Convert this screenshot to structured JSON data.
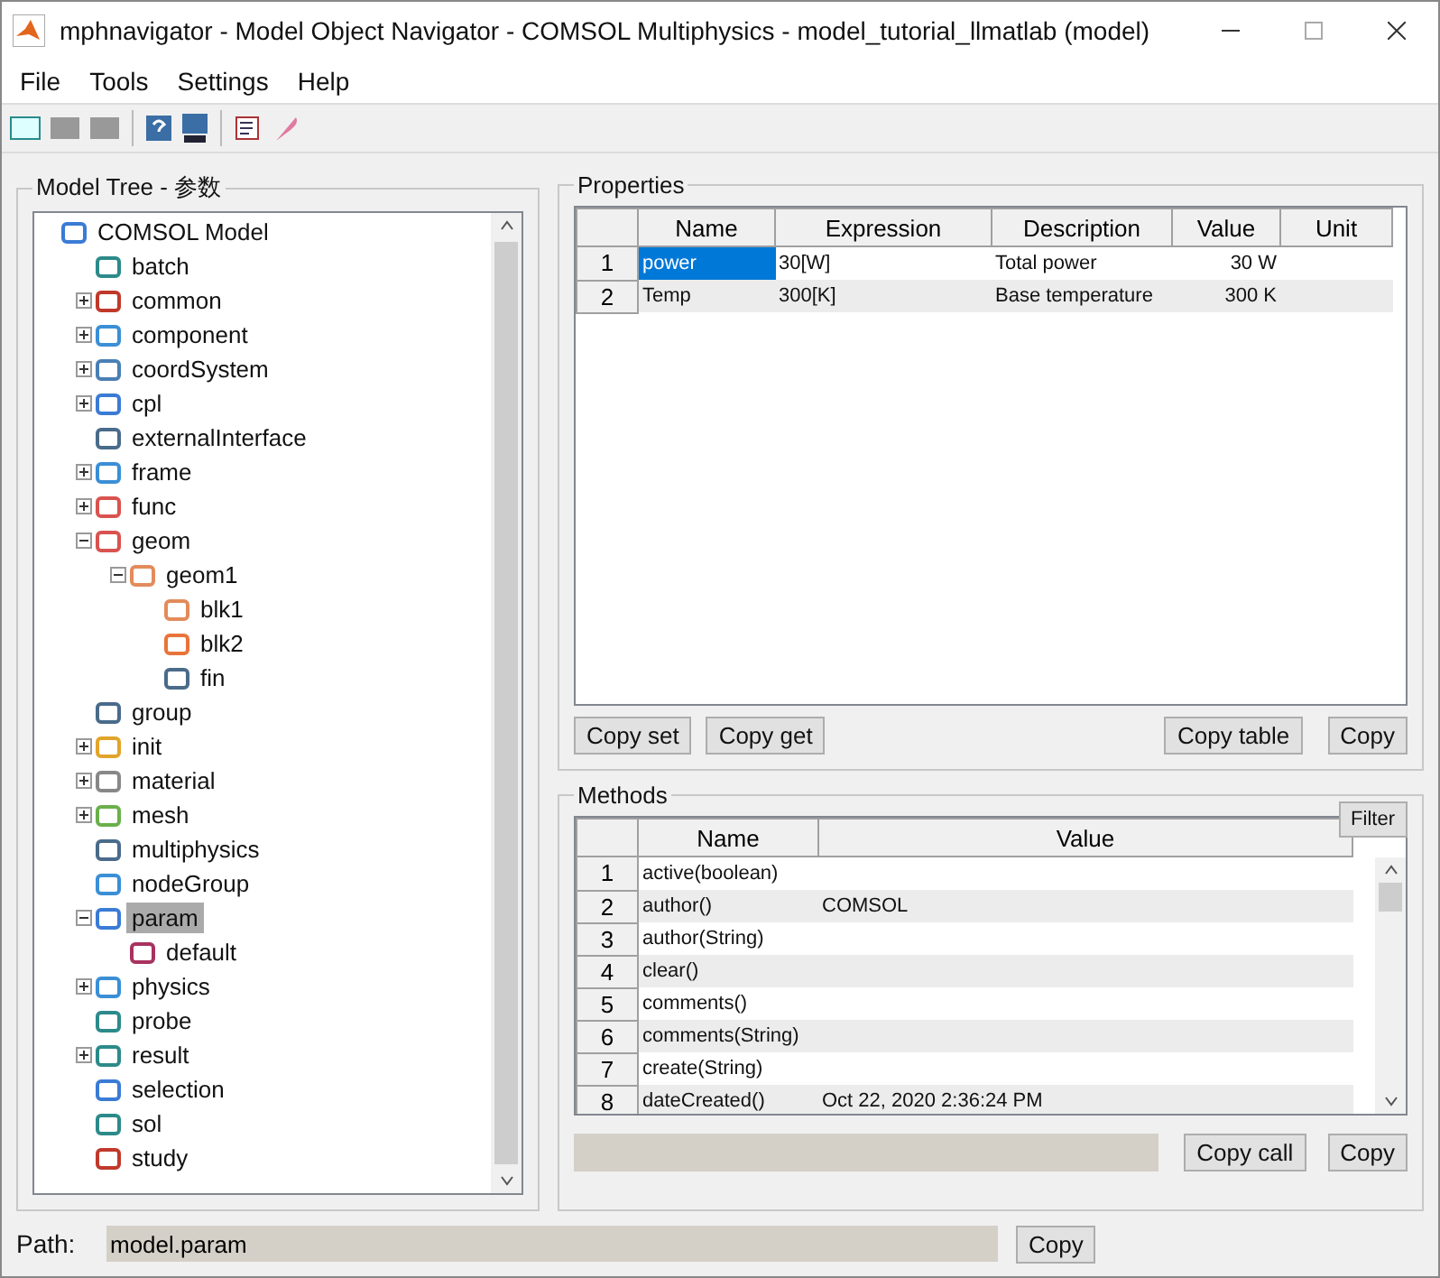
{
  "window": {
    "title": "mphnavigator - Model Object Navigator - COMSOL Multiphysics - model_tutorial_llmatlab (model)"
  },
  "menu": [
    "File",
    "Tools",
    "Settings",
    "Help"
  ],
  "model_tree": {
    "title": "Model Tree - 参数",
    "root": {
      "label": "COMSOL Model",
      "selected": false,
      "children": [
        {
          "label": "batch",
          "selected": false
        },
        {
          "label": "common",
          "expanded": false,
          "selected": false
        },
        {
          "label": "component",
          "expanded": false,
          "selected": false
        },
        {
          "label": "coordSystem",
          "expanded": false,
          "selected": false
        },
        {
          "label": "cpl",
          "expanded": false,
          "selected": false
        },
        {
          "label": "externalInterface",
          "selected": false
        },
        {
          "label": "frame",
          "expanded": false,
          "selected": false
        },
        {
          "label": "func",
          "expanded": false,
          "selected": false
        },
        {
          "label": "geom",
          "expanded": true,
          "selected": false,
          "children": [
            {
              "label": "geom1",
              "expanded": true,
              "selected": false,
              "children": [
                {
                  "label": "blk1",
                  "selected": false
                },
                {
                  "label": "blk2",
                  "selected": false
                },
                {
                  "label": "fin",
                  "selected": false
                }
              ]
            }
          ]
        },
        {
          "label": "group",
          "selected": false
        },
        {
          "label": "init",
          "expanded": false,
          "selected": false
        },
        {
          "label": "material",
          "expanded": false,
          "selected": false
        },
        {
          "label": "mesh",
          "expanded": false,
          "selected": false
        },
        {
          "label": "multiphysics",
          "selected": false
        },
        {
          "label": "nodeGroup",
          "selected": false
        },
        {
          "label": "param",
          "expanded": true,
          "selected": true,
          "children": [
            {
              "label": "default",
              "selected": false
            }
          ]
        },
        {
          "label": "physics",
          "expanded": false,
          "selected": false
        },
        {
          "label": "probe",
          "selected": false
        },
        {
          "label": "result",
          "expanded": false,
          "selected": false
        },
        {
          "label": "selection",
          "selected": false
        },
        {
          "label": "sol",
          "selected": false
        },
        {
          "label": "study",
          "selected": false
        }
      ]
    }
  },
  "properties": {
    "title": "Properties",
    "columns": [
      "Name",
      "Expression",
      "Description",
      "Value",
      "Unit"
    ],
    "rows": [
      {
        "number": "1",
        "cells": [
          "power",
          "30[W]",
          "Total power",
          "30 W",
          ""
        ],
        "selected": true
      },
      {
        "number": "2",
        "cells": [
          "Temp",
          "300[K]",
          "Base temperature",
          "300 K",
          ""
        ],
        "selected": false
      }
    ],
    "buttons": [
      "Copy set",
      "Copy get",
      "Copy table",
      "Copy"
    ]
  },
  "methods": {
    "title": "Methods",
    "filter": "Filter",
    "columns": [
      "Name",
      "Value"
    ],
    "rows": [
      {
        "number": "1",
        "name": "active(boolean)",
        "value": ""
      },
      {
        "number": "2",
        "name": "author()",
        "value": "COMSOL"
      },
      {
        "number": "3",
        "name": "author(String)",
        "value": ""
      },
      {
        "number": "4",
        "name": "clear()",
        "value": ""
      },
      {
        "number": "5",
        "name": "comments()",
        "value": ""
      },
      {
        "number": "6",
        "name": "comments(String)",
        "value": ""
      },
      {
        "number": "7",
        "name": "create(String)",
        "value": ""
      },
      {
        "number": "8",
        "name": "dateCreated()",
        "value": "Oct 22, 2020 2:36:24 PM"
      }
    ],
    "buttons": [
      "Copy call",
      "Copy"
    ]
  },
  "path": {
    "label": "Path:",
    "value": "model.param",
    "button": "Copy"
  }
}
